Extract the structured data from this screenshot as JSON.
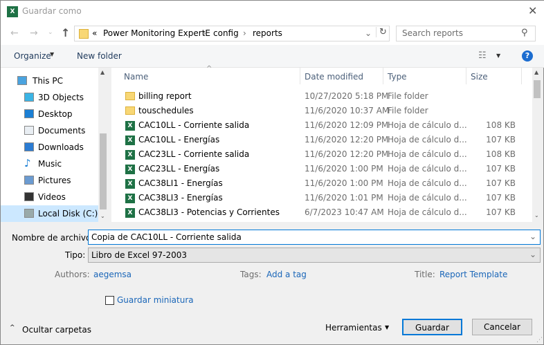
{
  "window": {
    "title": "Guardar como"
  },
  "address": {
    "crumbs": [
      "Power Monitoring ExpertE",
      "config",
      "reports"
    ],
    "overflow": "«"
  },
  "search": {
    "placeholder": "Search reports"
  },
  "toolbar": {
    "organize": "Organize",
    "new_folder": "New folder",
    "help": "?"
  },
  "sidebar": {
    "items": [
      {
        "label": "This PC",
        "icon": "computer-icon"
      },
      {
        "label": "3D Objects",
        "icon": "cube-icon"
      },
      {
        "label": "Desktop",
        "icon": "desktop-icon"
      },
      {
        "label": "Documents",
        "icon": "documents-icon"
      },
      {
        "label": "Downloads",
        "icon": "download-icon"
      },
      {
        "label": "Music",
        "icon": "music-icon"
      },
      {
        "label": "Pictures",
        "icon": "pictures-icon"
      },
      {
        "label": "Videos",
        "icon": "videos-icon"
      },
      {
        "label": "Local Disk (C:)",
        "icon": "disk-icon"
      }
    ]
  },
  "columns": {
    "name": "Name",
    "date": "Date modified",
    "type": "Type",
    "size": "Size"
  },
  "files": [
    {
      "name": "billing report",
      "date": "10/27/2020 5:18 PM",
      "type": "File folder",
      "size": "",
      "kind": "folder"
    },
    {
      "name": "touschedules",
      "date": "11/6/2020 10:37 AM",
      "type": "File folder",
      "size": "",
      "kind": "folder"
    },
    {
      "name": "CAC10LL - Corriente salida",
      "date": "11/6/2020 12:09 PM",
      "type": "Hoja de cálculo d...",
      "size": "108 KB",
      "kind": "excel"
    },
    {
      "name": "CAC10LL - Energías",
      "date": "11/6/2020 12:20 PM",
      "type": "Hoja de cálculo d...",
      "size": "107 KB",
      "kind": "excel"
    },
    {
      "name": "CAC23LL - Corriente salida",
      "date": "11/6/2020 12:20 PM",
      "type": "Hoja de cálculo d...",
      "size": "108 KB",
      "kind": "excel"
    },
    {
      "name": "CAC23LL - Energías",
      "date": "11/6/2020 1:00 PM",
      "type": "Hoja de cálculo d...",
      "size": "107 KB",
      "kind": "excel"
    },
    {
      "name": "CAC38LI1 - Energías",
      "date": "11/6/2020 1:00 PM",
      "type": "Hoja de cálculo d...",
      "size": "107 KB",
      "kind": "excel"
    },
    {
      "name": "CAC38LI3 - Energías",
      "date": "11/6/2020 1:01 PM",
      "type": "Hoja de cálculo d...",
      "size": "107 KB",
      "kind": "excel"
    },
    {
      "name": "CAC38LI3 - Potencias y Corrientes",
      "date": "6/7/2023 10:47 AM",
      "type": "Hoja de cálculo d...",
      "size": "107 KB",
      "kind": "excel"
    }
  ],
  "form": {
    "filename_label": "Nombre de archivo:",
    "filename_value": "Copia de CAC10LL - Corriente salida",
    "type_label": "Tipo:",
    "type_value": "Libro de Excel 97-2003",
    "authors_label": "Authors:",
    "authors_value": "aegemsa",
    "tags_label": "Tags:",
    "tags_value": "Add a tag",
    "title_label": "Title:",
    "title_value": "Report Template",
    "thumbnail_label": "Guardar miniatura"
  },
  "footer": {
    "hide_folders": "Ocultar carpetas",
    "tools": "Herramientas",
    "save": "Guardar",
    "cancel": "Cancelar"
  }
}
